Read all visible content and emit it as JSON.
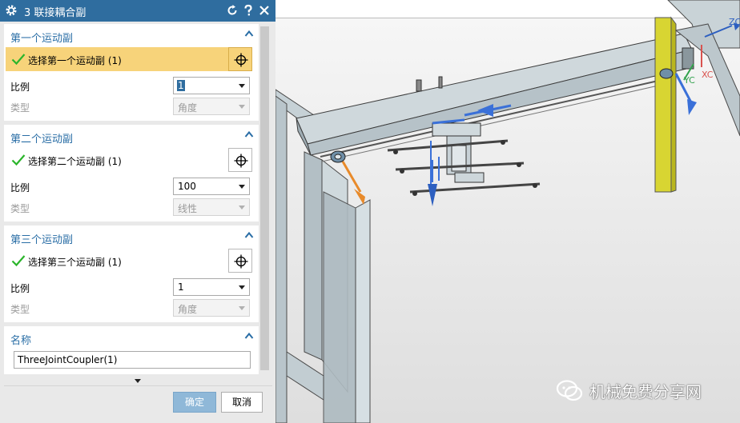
{
  "dialog": {
    "title": "3 联接耦合副",
    "groups": [
      {
        "title": "第一个运动副",
        "select_label": "选择第一个运动副 (1)",
        "ratio_label": "比例",
        "ratio_value": "1",
        "type_label": "类型",
        "type_value": "角度"
      },
      {
        "title": "第二个运动副",
        "select_label": "选择第二个运动副 (1)",
        "ratio_label": "比例",
        "ratio_value": "100",
        "type_label": "类型",
        "type_value": "线性"
      },
      {
        "title": "第三个运动副",
        "select_label": "选择第三个运动副 (1)",
        "ratio_label": "比例",
        "ratio_value": "1",
        "type_label": "类型",
        "type_value": "角度"
      }
    ],
    "name_group": {
      "title": "名称",
      "value": "ThreeJointCoupler(1)"
    },
    "ok_label": "确定",
    "cancel_label": "取消",
    "colors": {
      "title_bar": "#2f6d9f",
      "group_title": "#2a6ea6",
      "active_row": "#f7d37a",
      "check": "#2bb52b"
    },
    "icons": [
      "gear-icon",
      "reset-icon",
      "help-icon",
      "close-icon",
      "collapse-icon",
      "check-icon",
      "crosshair-icon",
      "dropdown-arrow-icon"
    ]
  },
  "viewport": {
    "axis_labels": {
      "zc_top": "ZC",
      "yc": "YC",
      "xc": "XC"
    },
    "watermark": "机械免费分享网"
  }
}
